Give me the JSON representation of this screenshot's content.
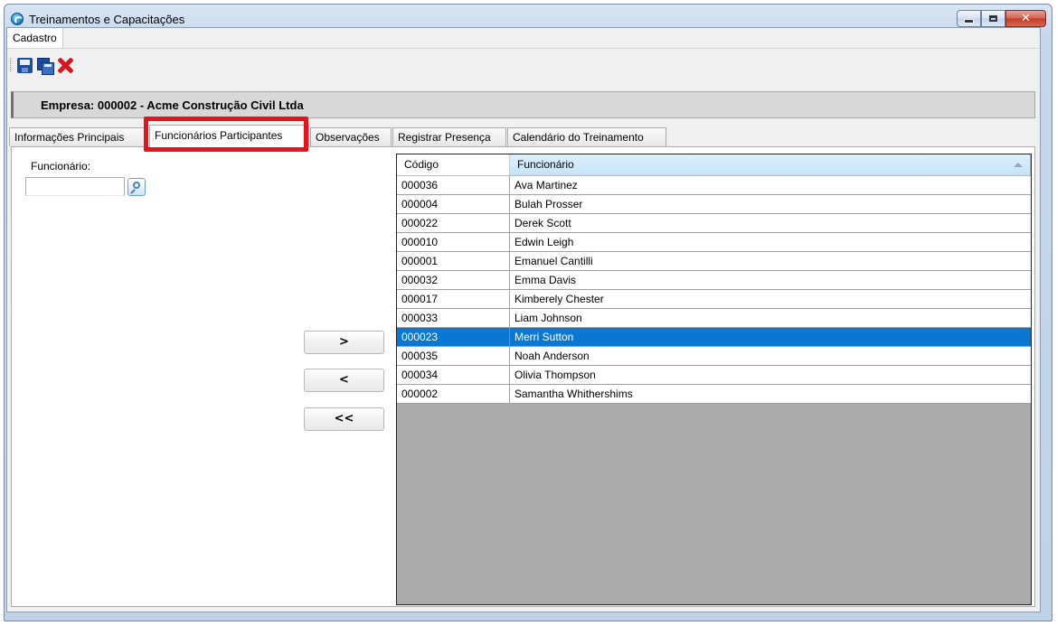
{
  "window": {
    "title": "Treinamentos e Capacitações",
    "controls": {
      "minimize": "minimize",
      "maximize": "maximize",
      "close": "✕"
    }
  },
  "menu": {
    "items": [
      "Cadastro"
    ]
  },
  "toolbar": {
    "icons": [
      "save-icon",
      "copy-icon",
      "delete-icon"
    ]
  },
  "company": {
    "label": "Empresa:  000002 - Acme Construção Civil Ltda"
  },
  "tabs": [
    {
      "label": "Informações Principais",
      "active": false
    },
    {
      "label": "Funcionários Participantes",
      "active": true
    },
    {
      "label": "Observações",
      "active": false
    },
    {
      "label": "Registrar Presença",
      "active": false
    },
    {
      "label": "Calendário do Treinamento",
      "active": false
    }
  ],
  "employee_field": {
    "label": "Funcionário:",
    "value": ""
  },
  "buttons": {
    "add": ">",
    "remove": "<",
    "remove_all": "<<"
  },
  "grid": {
    "columns": [
      "Código",
      "Funcionário"
    ],
    "sorted_column": "Funcionário",
    "rows": [
      {
        "code": "000036",
        "name": "Ava Martinez"
      },
      {
        "code": "000004",
        "name": "Bulah Prosser"
      },
      {
        "code": "000022",
        "name": "Derek Scott"
      },
      {
        "code": "000010",
        "name": "Edwin Leigh"
      },
      {
        "code": "000001",
        "name": "Emanuel Cantilli"
      },
      {
        "code": "000032",
        "name": "Emma Davis"
      },
      {
        "code": "000017",
        "name": "Kimberely Chester"
      },
      {
        "code": "000033",
        "name": "Liam Johnson"
      },
      {
        "code": "000023",
        "name": "Merri Sutton",
        "selected": true
      },
      {
        "code": "000035",
        "name": "Noah Anderson"
      },
      {
        "code": "000034",
        "name": "Olivia Thompson"
      },
      {
        "code": "000002",
        "name": "Samantha Whithershims"
      }
    ]
  },
  "colors": {
    "selection": "#0a78d2",
    "highlight_border": "#e8141c",
    "grid_empty": "#ababab"
  }
}
